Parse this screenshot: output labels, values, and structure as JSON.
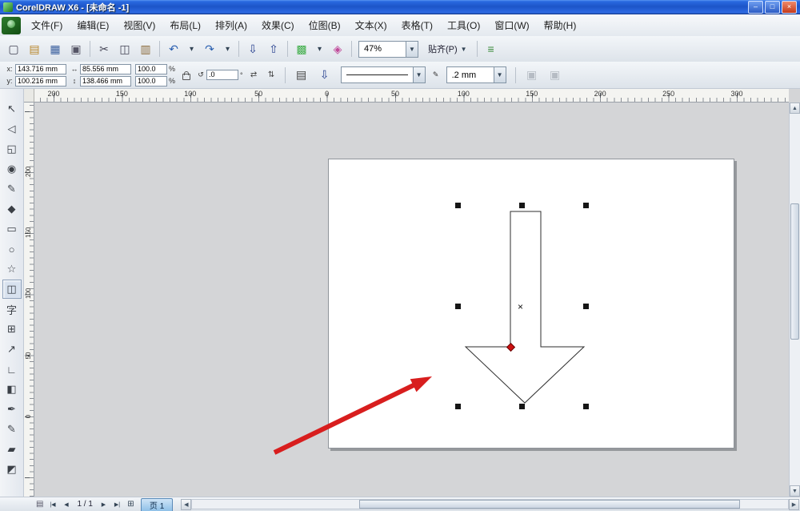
{
  "window": {
    "title": "CorelDRAW X6 - [未命名 -1]",
    "minimize_glyph": "–",
    "maximize_glyph": "□",
    "close_glyph": "×"
  },
  "menu": {
    "items": [
      "文件(F)",
      "编辑(E)",
      "视图(V)",
      "布局(L)",
      "排列(A)",
      "效果(C)",
      "位图(B)",
      "文本(X)",
      "表格(T)",
      "工具(O)",
      "窗口(W)",
      "帮助(H)"
    ]
  },
  "toolbar": {
    "buttons": [
      {
        "name": "new-document-button",
        "glyph": "▢",
        "color": "#445"
      },
      {
        "name": "open-button",
        "glyph": "▤",
        "color": "#b8862a"
      },
      {
        "name": "save-button",
        "glyph": "▦",
        "color": "#3a5f9e"
      },
      {
        "name": "print-button",
        "glyph": "▣",
        "color": "#556"
      },
      {
        "sep": true
      },
      {
        "name": "cut-button",
        "glyph": "✂",
        "color": "#445"
      },
      {
        "name": "copy-button",
        "glyph": "◫",
        "color": "#445"
      },
      {
        "name": "paste-button",
        "glyph": "▥",
        "color": "#8a6a3a"
      },
      {
        "sep": true
      },
      {
        "name": "undo-button",
        "glyph": "↶",
        "color": "#2a5fb0"
      },
      {
        "name": "undo-dropdown",
        "glyph": "▾",
        "small": true,
        "color": "#345"
      },
      {
        "name": "redo-button",
        "glyph": "↷",
        "color": "#2a5fb0"
      },
      {
        "name": "redo-dropdown",
        "glyph": "▾",
        "small": true,
        "color": "#345"
      },
      {
        "sep": true
      },
      {
        "name": "import-button",
        "glyph": "⇩",
        "color": "#27408f"
      },
      {
        "name": "export-button",
        "glyph": "⇧",
        "color": "#27408f"
      },
      {
        "sep": true
      },
      {
        "name": "application-launcher-button",
        "glyph": "▩",
        "color": "#3fae49"
      },
      {
        "name": "launcher-dropdown",
        "glyph": "▾",
        "small": true,
        "color": "#345"
      },
      {
        "name": "welcome-screen-button",
        "glyph": "◈",
        "color": "#c04a9a"
      },
      {
        "sep": true
      }
    ],
    "zoom_value": "47%",
    "snap_label": "贴齐(P)",
    "dropdown_glyph": "▼",
    "options_glyph": "≡"
  },
  "propbar": {
    "x_label": "x:",
    "x_value": "143.716 mm",
    "y_label": "y:",
    "y_value": "100.216 mm",
    "width_icon": "↔",
    "w_value": "85.556 mm",
    "height_icon": "↕",
    "h_value": "138.466 mm",
    "scale_x": "100.0",
    "scale_y": "100.0",
    "percent": "%",
    "rotate_icon": "↺",
    "angle_value": ".0",
    "degree": "°",
    "mirror_h_icon": "⇄",
    "mirror_v_icon": "⇅",
    "wrap_icon": "▤",
    "down_icon": "⇩",
    "pen_icon": "✎",
    "outline_width": ".2 mm",
    "disabled1_icon": "▣",
    "disabled2_icon": "▣"
  },
  "rulers": {
    "horizontal": [
      "200",
      "150",
      "100",
      "50",
      "0",
      "50",
      "100",
      "150",
      "200",
      "250",
      "300"
    ],
    "vertical": [
      "200",
      "150",
      "100",
      "50",
      "0"
    ]
  },
  "toolbox": {
    "active_index": 9,
    "tools": [
      {
        "name": "pick-tool",
        "glyph": "↖"
      },
      {
        "name": "shape-tool",
        "glyph": "◁"
      },
      {
        "name": "crop-tool",
        "glyph": "◱"
      },
      {
        "name": "zoom-tool",
        "glyph": "◉"
      },
      {
        "name": "freehand-tool",
        "glyph": "✎"
      },
      {
        "name": "smart-fill-tool",
        "glyph": "◆"
      },
      {
        "name": "rectangle-tool",
        "glyph": "▭"
      },
      {
        "name": "ellipse-tool",
        "glyph": "○"
      },
      {
        "name": "polygon-tool",
        "glyph": "☆"
      },
      {
        "name": "basic-shapes-tool",
        "glyph": "◫"
      },
      {
        "name": "text-tool",
        "glyph": "字"
      },
      {
        "name": "table-tool",
        "glyph": "⊞"
      },
      {
        "name": "dimension-tool",
        "glyph": "↗"
      },
      {
        "name": "connector-tool",
        "glyph": "∟"
      },
      {
        "name": "blend-tool",
        "glyph": "◧"
      },
      {
        "name": "eyedropper-tool",
        "glyph": "✒"
      },
      {
        "name": "outline-pen-tool",
        "glyph": "✎"
      },
      {
        "name": "fill-tool",
        "glyph": "▰"
      },
      {
        "name": "interactive-fill-tool",
        "glyph": "◩"
      }
    ]
  },
  "canvas": {
    "center_glyph": "×"
  },
  "scrollbars": {
    "up_glyph": "▲",
    "down_glyph": "▼",
    "left_glyph": "◀",
    "right_glyph": "▶"
  },
  "statusbar": {
    "page_icon_glyph": "▤",
    "first_glyph": "|◀",
    "prev_glyph": "◀",
    "page_info": "1 / 1",
    "next_glyph": "▶",
    "last_glyph": "▶|",
    "add_page_glyph": "⊞",
    "page_tab": "页 1"
  },
  "colors": {
    "titlebar_blue": "#1c55c8",
    "annotation_red": "#d81e1e",
    "node_red": "#cc1111",
    "page_tab_blue": "#8fc0e8"
  }
}
